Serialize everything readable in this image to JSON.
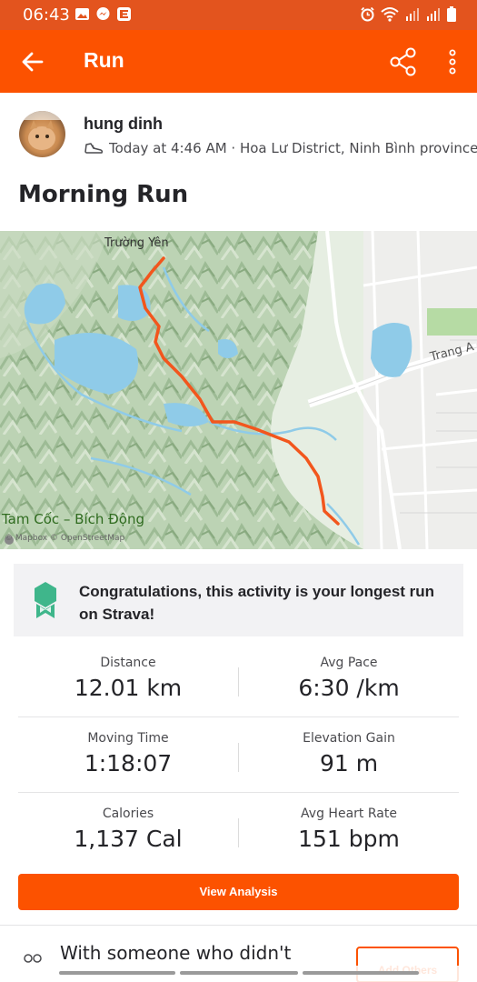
{
  "status_bar": {
    "time": "06:43",
    "left_icons": [
      "image-icon",
      "messenger-icon",
      "strava-icon"
    ],
    "right_icons": [
      "alarm-icon",
      "wifi-icon",
      "signal-icon",
      "signal-icon",
      "battery-icon"
    ]
  },
  "app_bar": {
    "title": "Run",
    "back_icon": "arrow-left-icon",
    "share_icon": "share-icon",
    "more_icon": "more-vertical-icon"
  },
  "activity": {
    "athlete_name": "hung dinh",
    "meta": "Today at 4:46 AM · Hoa Lư District, Ninh Bình province",
    "type_icon": "shoe-icon",
    "title": "Morning Run"
  },
  "map": {
    "labels": {
      "village": "Trường Yên",
      "road": "Trang A",
      "place": "Tam Cốc – Bích Động",
      "attribution": "© Mapbox © OpenStreetMap"
    },
    "route_color": "#f2561d"
  },
  "achievement": {
    "icon": "award-badge-icon",
    "text": "Congratulations, this activity is your longest run on Strava!"
  },
  "stats": [
    {
      "left": {
        "label": "Distance",
        "value": "12.01 km"
      },
      "right": {
        "label": "Avg Pace",
        "value": "6:30 /km"
      }
    },
    {
      "left": {
        "label": "Moving Time",
        "value": "1:18:07"
      },
      "right": {
        "label": "Elevation Gain",
        "value": "91 m"
      }
    },
    {
      "left": {
        "label": "Calories",
        "value": "1,137 Cal"
      },
      "right": {
        "label": "Avg Heart Rate",
        "value": "151 bpm"
      }
    }
  ],
  "view_analysis_label": "View Analysis",
  "with_others": {
    "text": "With someone who didn't",
    "button_label": "Add Others",
    "icon": "people-icon"
  },
  "colors": {
    "brand": "#fc5200",
    "status_bar": "#e3541e",
    "achievement_icon": "#3fb68b"
  }
}
